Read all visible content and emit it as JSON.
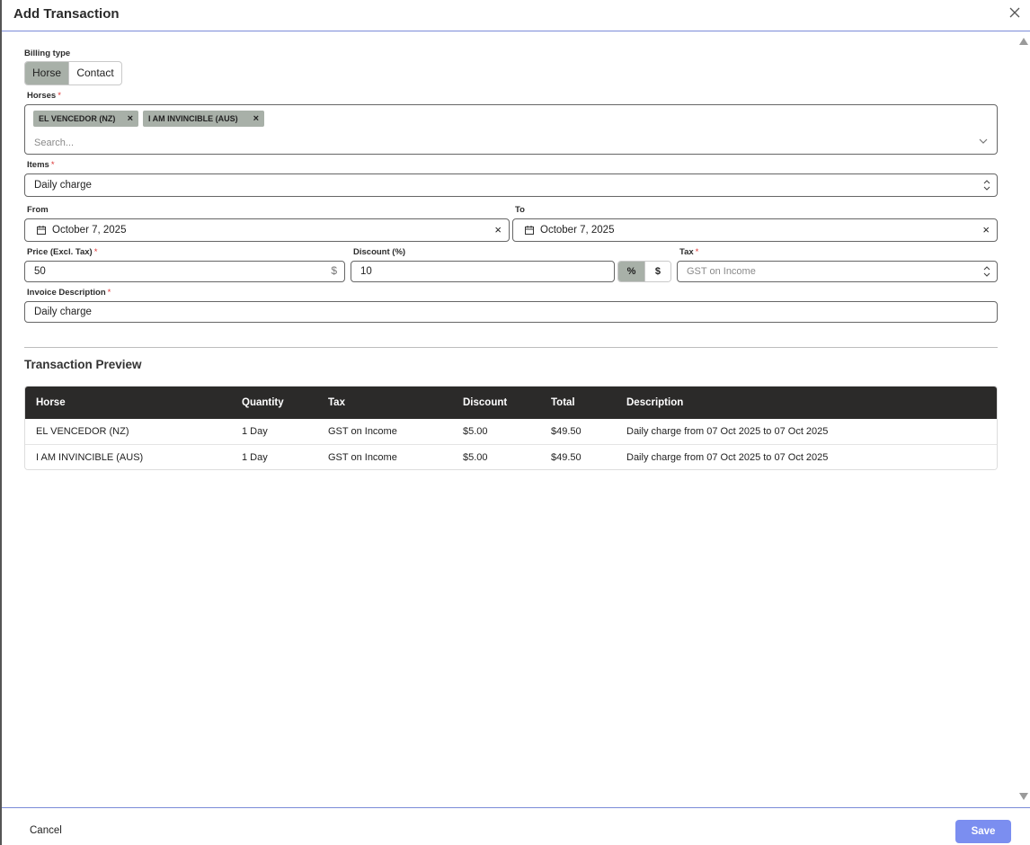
{
  "header": {
    "title": "Add Transaction"
  },
  "billing": {
    "label": "Billing type",
    "options": [
      "Horse",
      "Contact"
    ],
    "selected": "Horse"
  },
  "horses": {
    "label": "Horses",
    "required": "*",
    "chips": [
      "EL VENCEDOR (NZ)",
      "I AM INVINCIBLE (AUS)"
    ],
    "placeholder": "Search..."
  },
  "items": {
    "label": "Items",
    "required": "*",
    "value": "Daily charge"
  },
  "from": {
    "label": "From",
    "value": "October 7, 2025"
  },
  "to": {
    "label": "To",
    "value": "October 7, 2025"
  },
  "price": {
    "label": "Price (Excl. Tax)",
    "required": "*",
    "value": "50",
    "unit": "$"
  },
  "discount": {
    "label": "Discount (%)",
    "value": "10",
    "mode_percent": "%",
    "mode_dollar": "$",
    "selected_mode": "%"
  },
  "tax": {
    "label": "Tax",
    "required": "*",
    "placeholder": "GST on Income"
  },
  "invoice": {
    "label": "Invoice Description",
    "required": "*",
    "value": "Daily charge"
  },
  "preview": {
    "title": "Transaction Preview",
    "columns": [
      "Horse",
      "Quantity",
      "Tax",
      "Discount",
      "Total",
      "Description"
    ],
    "rows": [
      [
        "EL VENCEDOR (NZ)",
        "1 Day",
        "GST on Income",
        "$5.00",
        "$49.50",
        "Daily charge from 07 Oct 2025 to 07 Oct 2025"
      ],
      [
        "I AM INVINCIBLE (AUS)",
        "1 Day",
        "GST on Income",
        "$5.00",
        "$49.50",
        "Daily charge from 07 Oct 2025 to 07 Oct 2025"
      ]
    ]
  },
  "footer": {
    "cancel_label": "Cancel",
    "save_label": "Save"
  },
  "colors": {
    "accent": "#7b8ef0",
    "chip_bg": "#a8b0a8",
    "table_header_bg": "#2b2a29",
    "required": "#dd3333"
  },
  "icons": {
    "close": "close-icon",
    "calendar": "calendar-icon",
    "chip_remove": "x-icon",
    "chevron": "chevron-down-icon",
    "updown": "select-arrows-icon"
  }
}
